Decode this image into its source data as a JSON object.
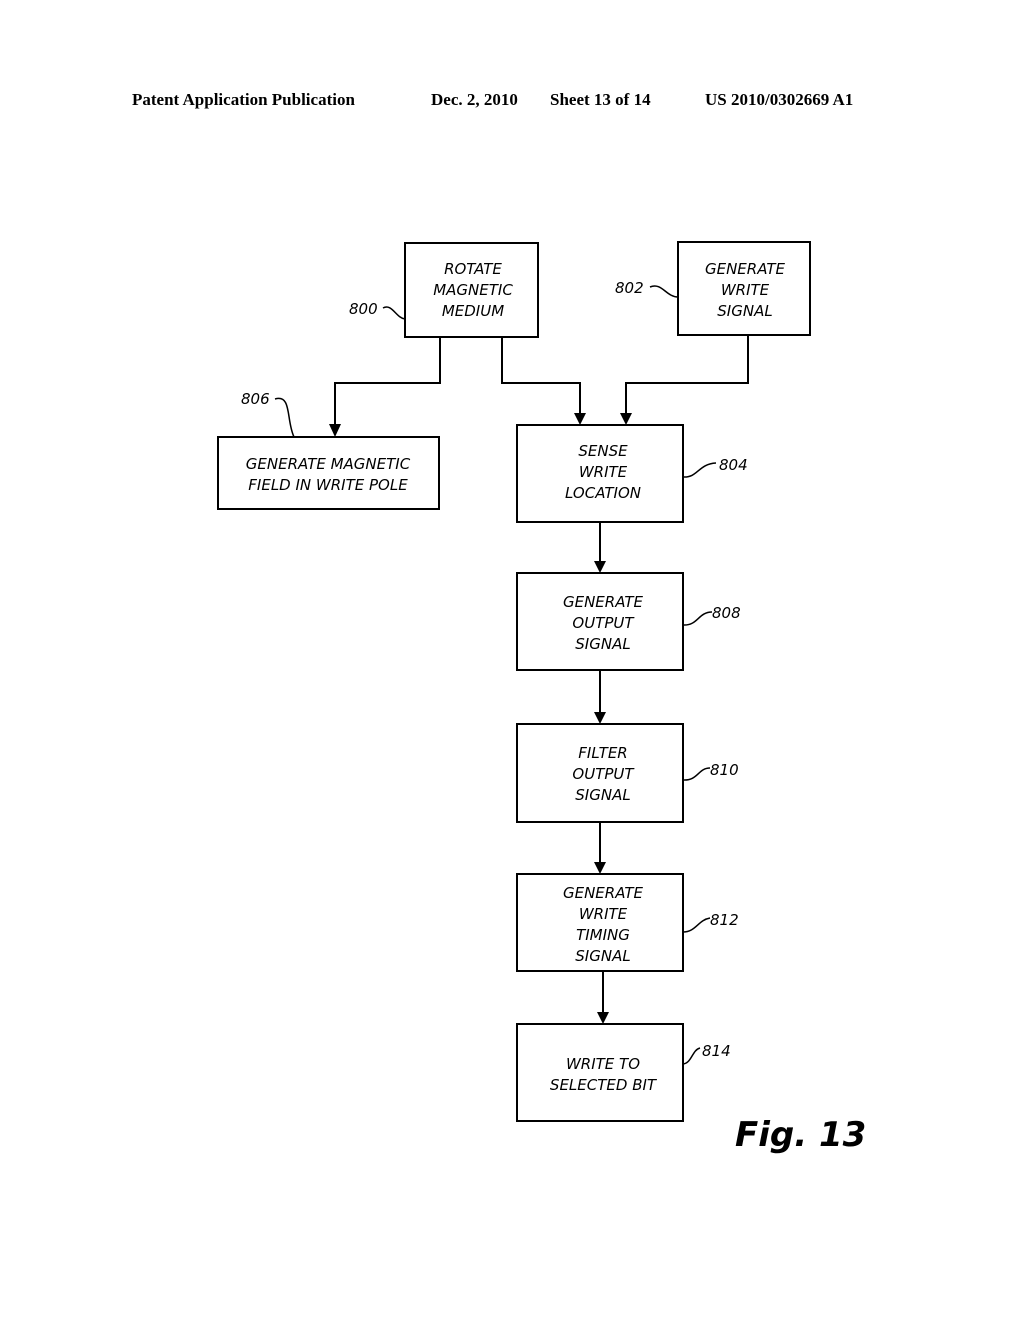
{
  "header": {
    "publication": "Patent Application Publication",
    "date": "Dec. 2, 2010",
    "sheet": "Sheet 13 of 14",
    "number": "US 2010/0302669 A1"
  },
  "figure_label": "Fig. 13",
  "boxes": [
    {
      "id": "800",
      "lines": [
        "ROTATE",
        "MAGNETIC",
        "MEDIUM"
      ]
    },
    {
      "id": "802",
      "lines": [
        "GENERATE",
        "WRITE",
        "SIGNAL"
      ]
    },
    {
      "id": "806",
      "lines": [
        "GENERATE MAGNETIC",
        "FIELD IN WRITE POLE"
      ]
    },
    {
      "id": "804",
      "lines": [
        "SENSE",
        "WRITE",
        "LOCATION"
      ]
    },
    {
      "id": "808",
      "lines": [
        "GENERATE",
        "OUTPUT",
        "SIGNAL"
      ]
    },
    {
      "id": "810",
      "lines": [
        "FILTER",
        "OUTPUT",
        "SIGNAL"
      ]
    },
    {
      "id": "812",
      "lines": [
        "GENERATE",
        "WRITE",
        "TIMING",
        "SIGNAL"
      ]
    },
    {
      "id": "814",
      "lines": [
        "WRITE TO",
        "SELECTED BIT"
      ]
    }
  ],
  "edges": [
    {
      "from": "800",
      "to": "806"
    },
    {
      "from": "800",
      "to": "804"
    },
    {
      "from": "802",
      "to": "804"
    },
    {
      "from": "804",
      "to": "808"
    },
    {
      "from": "808",
      "to": "810"
    },
    {
      "from": "810",
      "to": "812"
    },
    {
      "from": "812",
      "to": "814"
    }
  ]
}
